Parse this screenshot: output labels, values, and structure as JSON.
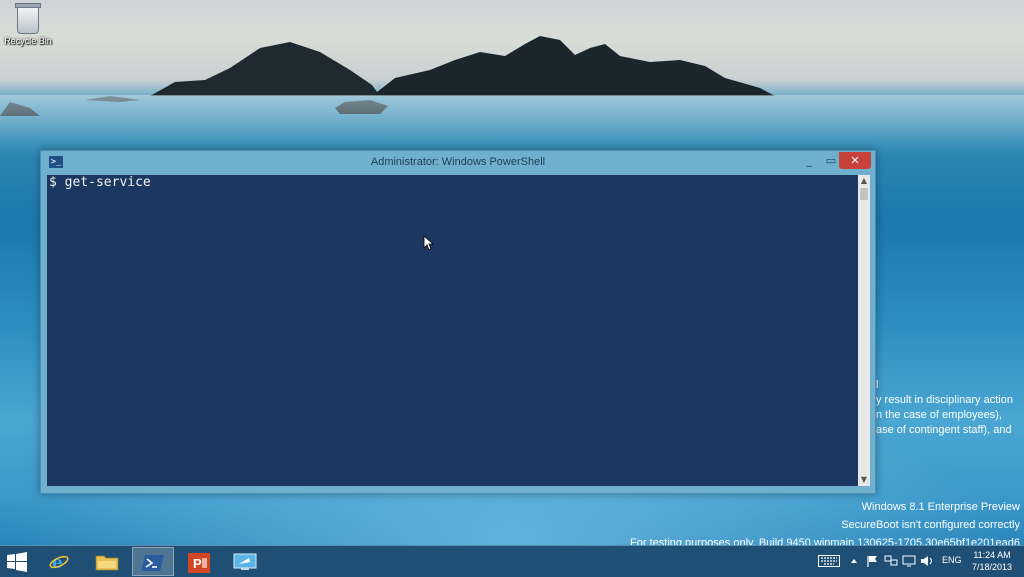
{
  "desktop": {
    "recycle_bin_label": "Recycle Bin",
    "icon": "recycle-bin-icon"
  },
  "window": {
    "title": "Administrator: Windows PowerShell",
    "minimize_glyph": "_",
    "maximize_glyph": "▭",
    "close_glyph": "✕",
    "console_lines": [
      "$ get-service"
    ],
    "colors": {
      "console_bg": "#1c3862",
      "close_button": "#c7403a",
      "frame": "#6fb0cf"
    }
  },
  "background_text": {
    "lines": [
      "l",
      "y result in disciplinary action",
      "n the case of employees),",
      "ase of contingent staff), and"
    ]
  },
  "watermark": {
    "edition": "Windows 8.1 Enterprise Preview",
    "secureboot": "SecureBoot isn't configured correctly",
    "build": "For testing purposes only. Build 9450.winmain.130625-1705.30e65bf1e201ead6"
  },
  "taskbar": {
    "pinned": [
      {
        "name": "internet-explorer",
        "icon": "ie-icon"
      },
      {
        "name": "file-explorer",
        "icon": "folder-icon"
      },
      {
        "name": "powershell",
        "icon": "powershell-icon",
        "active": true
      },
      {
        "name": "powerpoint",
        "icon": "powerpoint-icon"
      },
      {
        "name": "remote-desktop",
        "icon": "remote-desktop-icon"
      }
    ],
    "tray": {
      "language": "ENG",
      "time": "11:24 AM",
      "date": "7/18/2013",
      "icons": [
        "keyboard-icon",
        "chevron-up-icon",
        "flag-icon",
        "network-icon",
        "display-icon",
        "volume-icon"
      ]
    }
  }
}
